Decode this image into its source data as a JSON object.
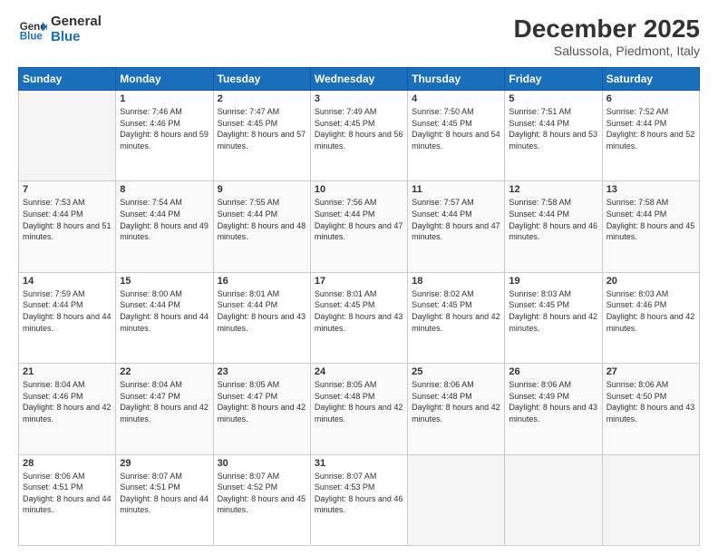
{
  "logo": {
    "line1": "General",
    "line2": "Blue"
  },
  "header": {
    "month": "December 2025",
    "location": "Salussola, Piedmont, Italy"
  },
  "weekdays": [
    "Sunday",
    "Monday",
    "Tuesday",
    "Wednesday",
    "Thursday",
    "Friday",
    "Saturday"
  ],
  "weeks": [
    [
      {
        "day": "",
        "sunrise": "",
        "sunset": "",
        "daylight": ""
      },
      {
        "day": "1",
        "sunrise": "Sunrise: 7:46 AM",
        "sunset": "Sunset: 4:46 PM",
        "daylight": "Daylight: 8 hours and 59 minutes."
      },
      {
        "day": "2",
        "sunrise": "Sunrise: 7:47 AM",
        "sunset": "Sunset: 4:45 PM",
        "daylight": "Daylight: 8 hours and 57 minutes."
      },
      {
        "day": "3",
        "sunrise": "Sunrise: 7:49 AM",
        "sunset": "Sunset: 4:45 PM",
        "daylight": "Daylight: 8 hours and 56 minutes."
      },
      {
        "day": "4",
        "sunrise": "Sunrise: 7:50 AM",
        "sunset": "Sunset: 4:45 PM",
        "daylight": "Daylight: 8 hours and 54 minutes."
      },
      {
        "day": "5",
        "sunrise": "Sunrise: 7:51 AM",
        "sunset": "Sunset: 4:44 PM",
        "daylight": "Daylight: 8 hours and 53 minutes."
      },
      {
        "day": "6",
        "sunrise": "Sunrise: 7:52 AM",
        "sunset": "Sunset: 4:44 PM",
        "daylight": "Daylight: 8 hours and 52 minutes."
      }
    ],
    [
      {
        "day": "7",
        "sunrise": "Sunrise: 7:53 AM",
        "sunset": "Sunset: 4:44 PM",
        "daylight": "Daylight: 8 hours and 51 minutes."
      },
      {
        "day": "8",
        "sunrise": "Sunrise: 7:54 AM",
        "sunset": "Sunset: 4:44 PM",
        "daylight": "Daylight: 8 hours and 49 minutes."
      },
      {
        "day": "9",
        "sunrise": "Sunrise: 7:55 AM",
        "sunset": "Sunset: 4:44 PM",
        "daylight": "Daylight: 8 hours and 48 minutes."
      },
      {
        "day": "10",
        "sunrise": "Sunrise: 7:56 AM",
        "sunset": "Sunset: 4:44 PM",
        "daylight": "Daylight: 8 hours and 47 minutes."
      },
      {
        "day": "11",
        "sunrise": "Sunrise: 7:57 AM",
        "sunset": "Sunset: 4:44 PM",
        "daylight": "Daylight: 8 hours and 47 minutes."
      },
      {
        "day": "12",
        "sunrise": "Sunrise: 7:58 AM",
        "sunset": "Sunset: 4:44 PM",
        "daylight": "Daylight: 8 hours and 46 minutes."
      },
      {
        "day": "13",
        "sunrise": "Sunrise: 7:58 AM",
        "sunset": "Sunset: 4:44 PM",
        "daylight": "Daylight: 8 hours and 45 minutes."
      }
    ],
    [
      {
        "day": "14",
        "sunrise": "Sunrise: 7:59 AM",
        "sunset": "Sunset: 4:44 PM",
        "daylight": "Daylight: 8 hours and 44 minutes."
      },
      {
        "day": "15",
        "sunrise": "Sunrise: 8:00 AM",
        "sunset": "Sunset: 4:44 PM",
        "daylight": "Daylight: 8 hours and 44 minutes."
      },
      {
        "day": "16",
        "sunrise": "Sunrise: 8:01 AM",
        "sunset": "Sunset: 4:44 PM",
        "daylight": "Daylight: 8 hours and 43 minutes."
      },
      {
        "day": "17",
        "sunrise": "Sunrise: 8:01 AM",
        "sunset": "Sunset: 4:45 PM",
        "daylight": "Daylight: 8 hours and 43 minutes."
      },
      {
        "day": "18",
        "sunrise": "Sunrise: 8:02 AM",
        "sunset": "Sunset: 4:45 PM",
        "daylight": "Daylight: 8 hours and 42 minutes."
      },
      {
        "day": "19",
        "sunrise": "Sunrise: 8:03 AM",
        "sunset": "Sunset: 4:45 PM",
        "daylight": "Daylight: 8 hours and 42 minutes."
      },
      {
        "day": "20",
        "sunrise": "Sunrise: 8:03 AM",
        "sunset": "Sunset: 4:46 PM",
        "daylight": "Daylight: 8 hours and 42 minutes."
      }
    ],
    [
      {
        "day": "21",
        "sunrise": "Sunrise: 8:04 AM",
        "sunset": "Sunset: 4:46 PM",
        "daylight": "Daylight: 8 hours and 42 minutes."
      },
      {
        "day": "22",
        "sunrise": "Sunrise: 8:04 AM",
        "sunset": "Sunset: 4:47 PM",
        "daylight": "Daylight: 8 hours and 42 minutes."
      },
      {
        "day": "23",
        "sunrise": "Sunrise: 8:05 AM",
        "sunset": "Sunset: 4:47 PM",
        "daylight": "Daylight: 8 hours and 42 minutes."
      },
      {
        "day": "24",
        "sunrise": "Sunrise: 8:05 AM",
        "sunset": "Sunset: 4:48 PM",
        "daylight": "Daylight: 8 hours and 42 minutes."
      },
      {
        "day": "25",
        "sunrise": "Sunrise: 8:06 AM",
        "sunset": "Sunset: 4:48 PM",
        "daylight": "Daylight: 8 hours and 42 minutes."
      },
      {
        "day": "26",
        "sunrise": "Sunrise: 8:06 AM",
        "sunset": "Sunset: 4:49 PM",
        "daylight": "Daylight: 8 hours and 43 minutes."
      },
      {
        "day": "27",
        "sunrise": "Sunrise: 8:06 AM",
        "sunset": "Sunset: 4:50 PM",
        "daylight": "Daylight: 8 hours and 43 minutes."
      }
    ],
    [
      {
        "day": "28",
        "sunrise": "Sunrise: 8:06 AM",
        "sunset": "Sunset: 4:51 PM",
        "daylight": "Daylight: 8 hours and 44 minutes."
      },
      {
        "day": "29",
        "sunrise": "Sunrise: 8:07 AM",
        "sunset": "Sunset: 4:51 PM",
        "daylight": "Daylight: 8 hours and 44 minutes."
      },
      {
        "day": "30",
        "sunrise": "Sunrise: 8:07 AM",
        "sunset": "Sunset: 4:52 PM",
        "daylight": "Daylight: 8 hours and 45 minutes."
      },
      {
        "day": "31",
        "sunrise": "Sunrise: 8:07 AM",
        "sunset": "Sunset: 4:53 PM",
        "daylight": "Daylight: 8 hours and 46 minutes."
      },
      {
        "day": "",
        "sunrise": "",
        "sunset": "",
        "daylight": ""
      },
      {
        "day": "",
        "sunrise": "",
        "sunset": "",
        "daylight": ""
      },
      {
        "day": "",
        "sunrise": "",
        "sunset": "",
        "daylight": ""
      }
    ]
  ]
}
